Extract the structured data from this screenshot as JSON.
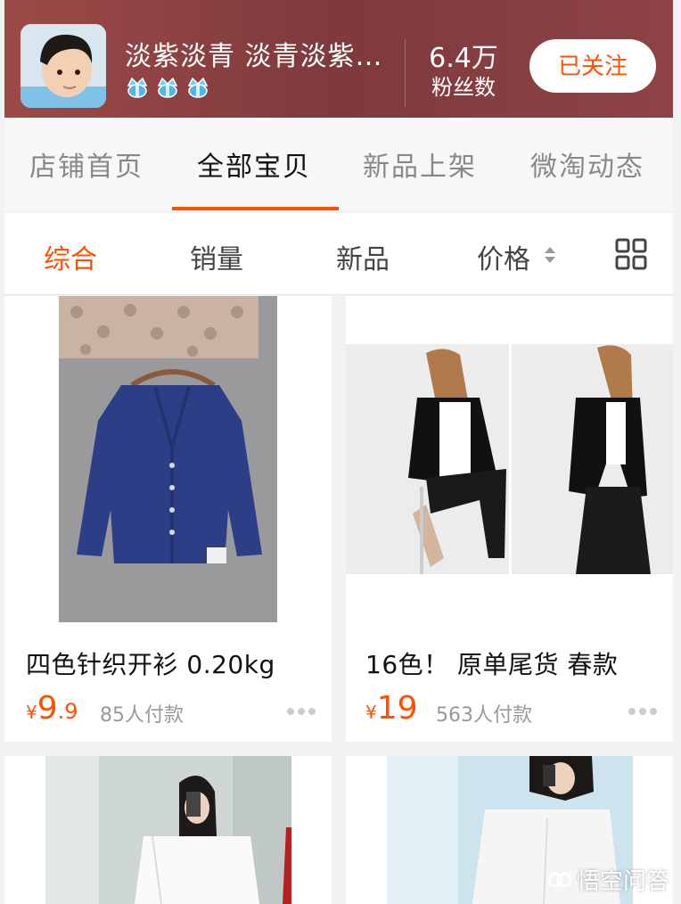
{
  "header": {
    "shop_name": "淡紫淡青 淡青淡紫…",
    "crowns": [
      "crown-icon",
      "crown-icon",
      "crown-icon"
    ],
    "fans_count": "6.4万",
    "fans_label": "粉丝数",
    "follow_label": "已关注"
  },
  "tabs": [
    {
      "label": "店铺首页",
      "active": false
    },
    {
      "label": "全部宝贝",
      "active": true
    },
    {
      "label": "新品上架",
      "active": false
    },
    {
      "label": "微淘动态",
      "active": false
    }
  ],
  "sort": [
    {
      "label": "综合",
      "active": true
    },
    {
      "label": "销量",
      "active": false
    },
    {
      "label": "新品",
      "active": false
    },
    {
      "label": "价格",
      "active": false
    }
  ],
  "products": [
    {
      "title": "四色针织开衫  0.20kg",
      "price_symbol": "¥",
      "price_int": "9",
      "price_dec": ".9",
      "sold": "85人付款"
    },
    {
      "title": "16色！ 原单尾货 春款",
      "price_symbol": "¥",
      "price_int": "19",
      "price_dec": "",
      "sold": "563人付款"
    }
  ],
  "watermark": "悟空问答",
  "colors": {
    "accent": "#ff5000",
    "header_bg": "#8a4043"
  }
}
